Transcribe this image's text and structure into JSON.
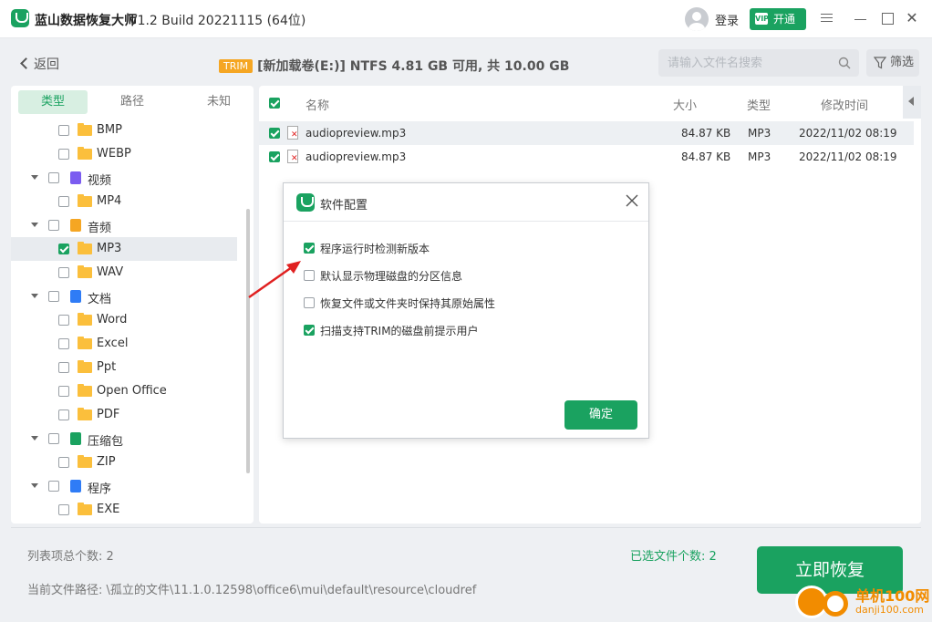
{
  "app": {
    "name": "蓝山数据恢复大师",
    "version": "V1.2 Build 20221115 (64位)",
    "login_label": "登录",
    "vip_label": "开通",
    "vip_badge": "VIP"
  },
  "toolbar": {
    "back_label": "返回",
    "trim_badge": "TRIM",
    "drive_info": "[新加载卷(E:)] NTFS   4.81 GB 可用, 共 10.00 GB",
    "search_placeholder": "请输入文件名搜索",
    "filter_label": "筛选"
  },
  "sidebar": {
    "tabs": [
      "类型",
      "路径",
      "未知"
    ],
    "tree": [
      {
        "label": "BMP",
        "kind": "folder",
        "level": 1,
        "checked": false
      },
      {
        "label": "WEBP",
        "kind": "folder",
        "level": 1,
        "checked": false
      },
      {
        "label": "视频",
        "kind": "category",
        "level": 0,
        "checked": false,
        "icon": "video-icon",
        "color": "#7b5cf0"
      },
      {
        "label": "MP4",
        "kind": "folder",
        "level": 1,
        "checked": false
      },
      {
        "label": "音频",
        "kind": "category",
        "level": 0,
        "checked": false,
        "icon": "audio-icon",
        "color": "#f5a623"
      },
      {
        "label": "MP3",
        "kind": "folder",
        "level": 1,
        "checked": true,
        "selected": true
      },
      {
        "label": "WAV",
        "kind": "folder",
        "level": 1,
        "checked": false
      },
      {
        "label": "文档",
        "kind": "category",
        "level": 0,
        "checked": false,
        "icon": "document-icon",
        "color": "#2f7cf6"
      },
      {
        "label": "Word",
        "kind": "folder",
        "level": 1,
        "checked": false
      },
      {
        "label": "Excel",
        "kind": "folder",
        "level": 1,
        "checked": false
      },
      {
        "label": "Ppt",
        "kind": "folder",
        "level": 1,
        "checked": false
      },
      {
        "label": "Open Office",
        "kind": "folder",
        "level": 1,
        "checked": false
      },
      {
        "label": "PDF",
        "kind": "folder",
        "level": 1,
        "checked": false
      },
      {
        "label": "压缩包",
        "kind": "category",
        "level": 0,
        "checked": false,
        "icon": "archive-icon",
        "color": "#1aa260"
      },
      {
        "label": "ZIP",
        "kind": "folder",
        "level": 1,
        "checked": false
      },
      {
        "label": "程序",
        "kind": "category",
        "level": 0,
        "checked": false,
        "icon": "program-icon",
        "color": "#2f7cf6"
      },
      {
        "label": "EXE",
        "kind": "folder",
        "level": 1,
        "checked": false
      }
    ]
  },
  "file_list": {
    "headers": {
      "name": "名称",
      "size": "大小",
      "type": "类型",
      "modified": "修改时间"
    },
    "rows": [
      {
        "name": "audiopreview.mp3",
        "size": "84.87 KB",
        "type": "MP3",
        "modified": "2022/11/02  08:19",
        "checked": true
      },
      {
        "name": "audiopreview.mp3",
        "size": "84.87 KB",
        "type": "MP3",
        "modified": "2022/11/02  08:19",
        "checked": true
      }
    ]
  },
  "footer": {
    "total_count": "列表项总个数: 2",
    "current_path": "当前文件路径: \\孤立的文件\\11.1.0.12598\\office6\\mui\\default\\resource\\cloudref",
    "selected_count": "已选文件个数: 2",
    "recover_label": "立即恢复"
  },
  "dialog": {
    "title": "软件配置",
    "options": [
      {
        "label": "程序运行时检测新版本",
        "checked": true
      },
      {
        "label": "默认显示物理磁盘的分区信息",
        "checked": false
      },
      {
        "label": "恢复文件或文件夹时保持其原始属性",
        "checked": false
      },
      {
        "label": "扫描支持TRIM的磁盘前提示用户",
        "checked": true
      }
    ],
    "ok_label": "确定"
  },
  "watermark": {
    "line1": "单机100网",
    "line2": "danji100.com"
  },
  "colors": {
    "accent": "#1aa260",
    "trim": "#f5a623",
    "annotation_arrow": "#e02020"
  }
}
